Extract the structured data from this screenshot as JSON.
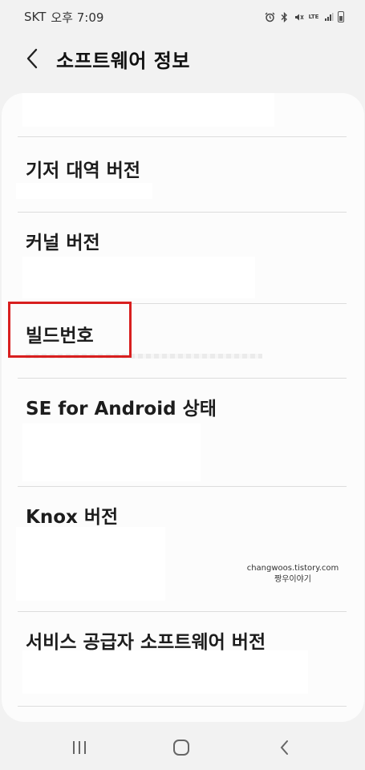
{
  "status_bar": {
    "carrier": "SKT",
    "time": "오후 7:09",
    "icons": [
      "alarm-icon",
      "bluetooth-icon",
      "mute-icon",
      "lte-icon",
      "signal-icon",
      "battery-icon"
    ],
    "lte_label": "LTE"
  },
  "header": {
    "back_icon": "chevron-left-icon",
    "title": "소프트웨어 정보"
  },
  "rows": [
    {
      "title": "",
      "value": ""
    },
    {
      "title": "기저 대역 버전",
      "value": ""
    },
    {
      "title": "커널 버전",
      "value": ""
    },
    {
      "title": "빌드번호",
      "value": "",
      "highlighted": true
    },
    {
      "title": "SE for Android 상태",
      "value": ""
    },
    {
      "title": "Knox 버전",
      "value": ""
    },
    {
      "title": "서비스 공급자 소프트웨어 버전",
      "value": ""
    }
  ],
  "watermark": {
    "line1": "changwoos.tistory.com",
    "line2": "짱우이야기"
  },
  "nav_bar": {
    "recents_icon": "recents-icon",
    "home_icon": "home-icon",
    "back_icon": "back-chevron-icon"
  },
  "colors": {
    "highlight": "#d81f1f",
    "background": "#f2f2f2",
    "card": "#fcfcfc"
  }
}
